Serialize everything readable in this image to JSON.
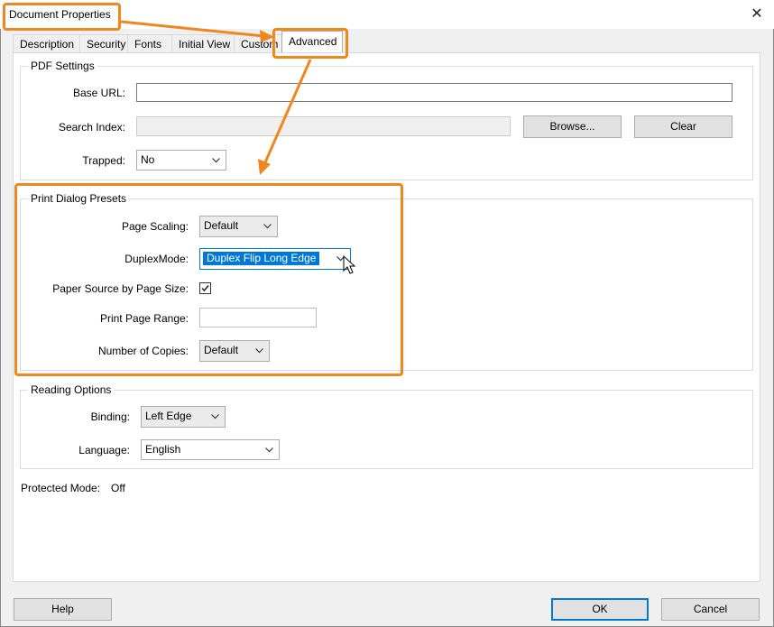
{
  "window": {
    "title": "Document Properties"
  },
  "tabs": [
    {
      "label": "Description"
    },
    {
      "label": "Security"
    },
    {
      "label": "Fonts"
    },
    {
      "label": "Initial View"
    },
    {
      "label": "Custom"
    },
    {
      "label": "Advanced",
      "active": true
    }
  ],
  "pdf_settings": {
    "title": "PDF Settings",
    "base_url_label": "Base URL:",
    "base_url_value": "",
    "search_index_label": "Search Index:",
    "search_index_value": "",
    "browse_label": "Browse...",
    "clear_label": "Clear",
    "trapped_label": "Trapped:",
    "trapped_value": "No"
  },
  "print_presets": {
    "title": "Print Dialog Presets",
    "page_scaling_label": "Page Scaling:",
    "page_scaling_value": "Default",
    "duplex_label": "DuplexMode:",
    "duplex_value": "Duplex Flip Long Edge",
    "paper_source_label": "Paper Source by Page Size:",
    "paper_source_checked": true,
    "print_range_label": "Print Page Range:",
    "print_range_value": "",
    "copies_label": "Number of Copies:",
    "copies_value": "Default"
  },
  "reading_options": {
    "title": "Reading Options",
    "binding_label": "Binding:",
    "binding_value": "Left Edge",
    "language_label": "Language:",
    "language_value": "English"
  },
  "protected_mode": {
    "label": "Protected Mode:",
    "value": "Off"
  },
  "footer": {
    "help_label": "Help",
    "ok_label": "OK",
    "cancel_label": "Cancel"
  },
  "colors": {
    "highlight": "#f0861c",
    "selection": "#0078d7"
  }
}
